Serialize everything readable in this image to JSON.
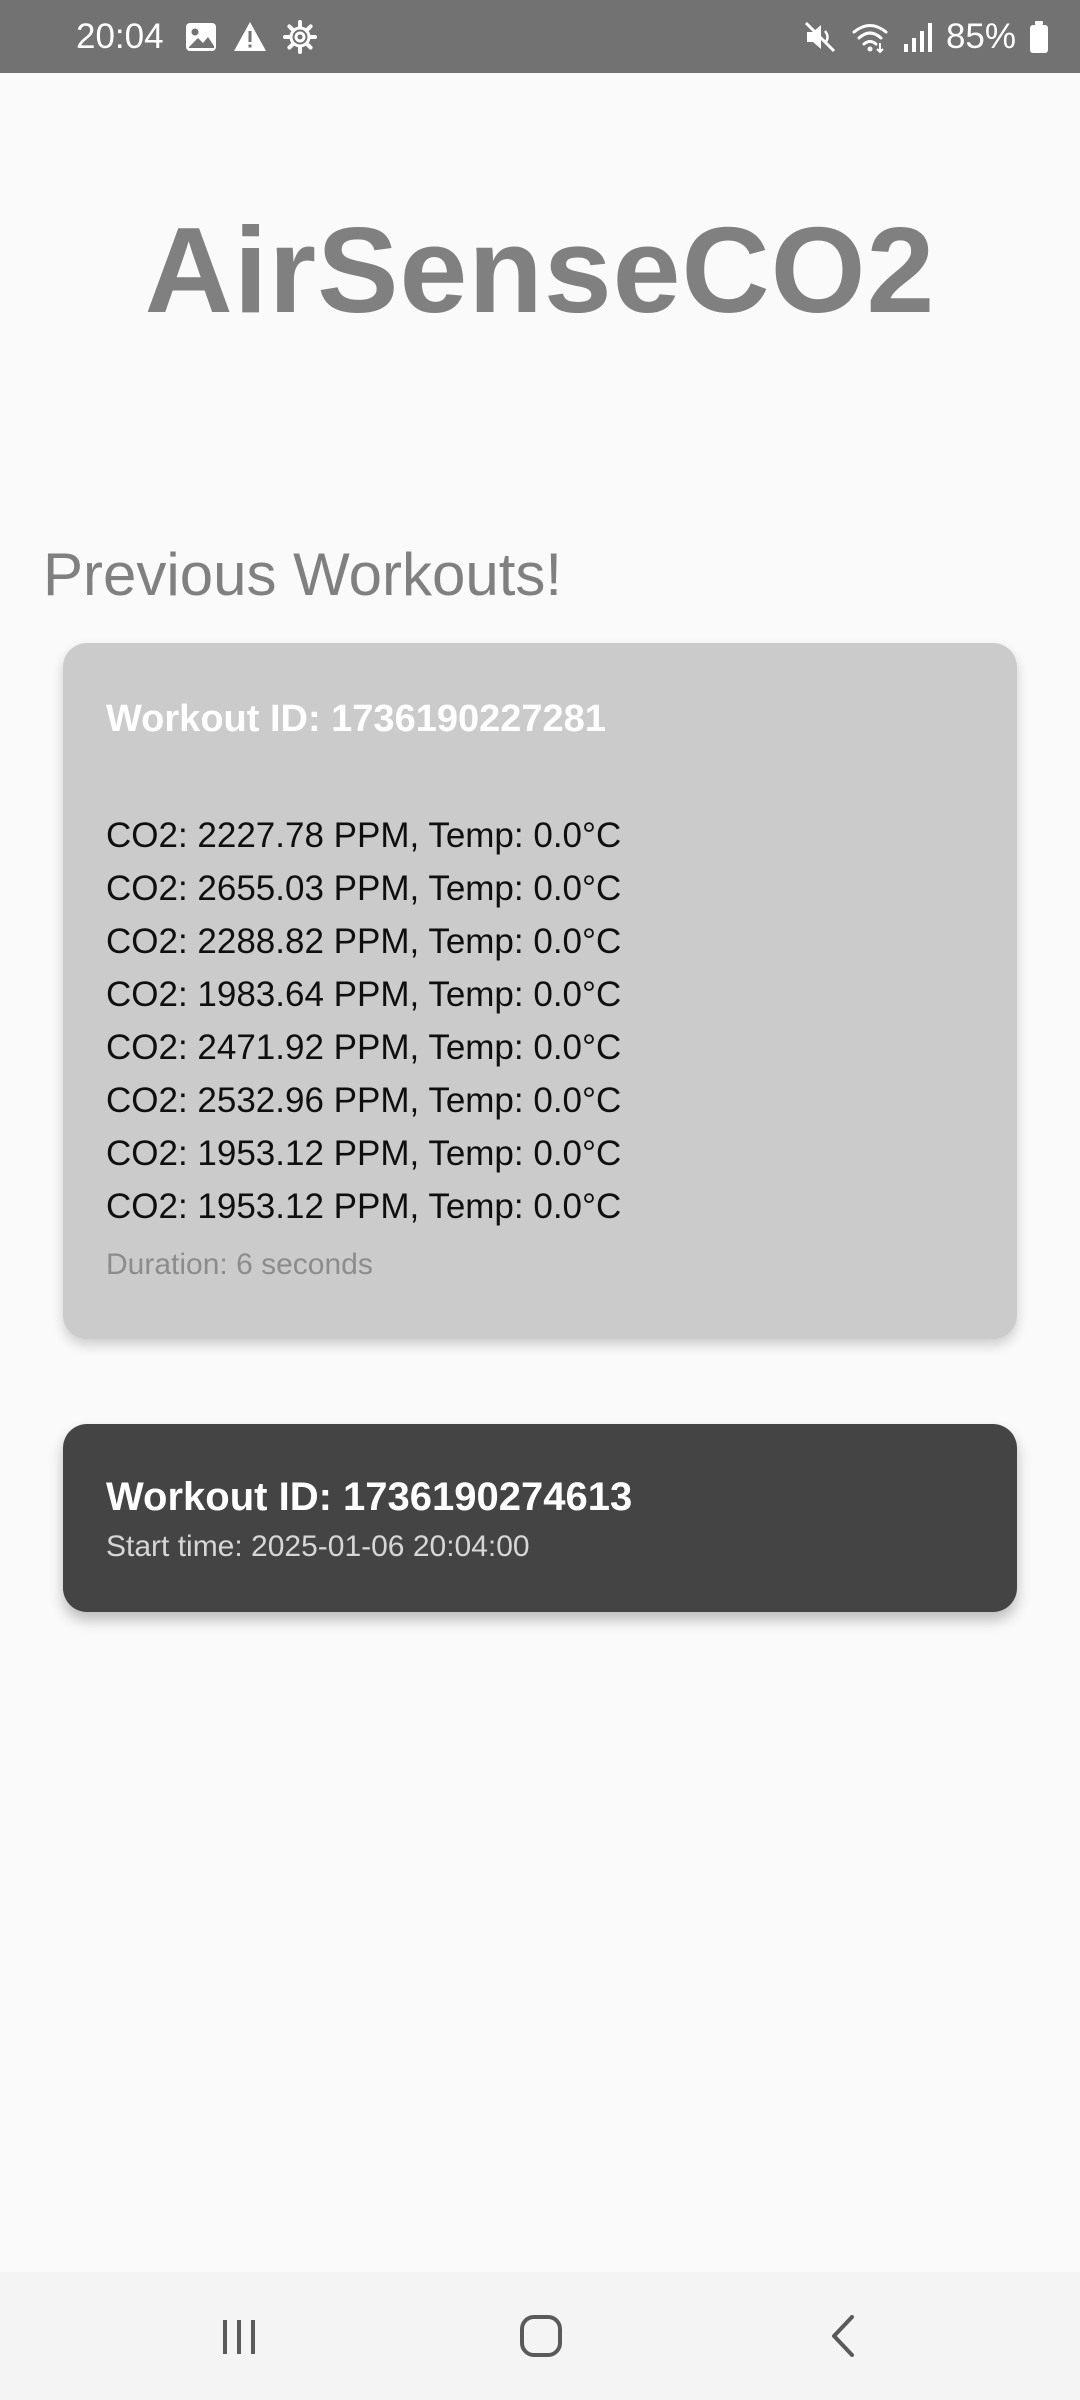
{
  "status_bar": {
    "time": "20:04",
    "left_icons": [
      "image-icon",
      "warning-icon",
      "settings-icon"
    ],
    "right_icons": [
      "mute-icon",
      "wifi-icon",
      "signal-icon"
    ],
    "battery_percent": "85%"
  },
  "app": {
    "title": "AirSenseCO2"
  },
  "section": {
    "heading": "Previous Workouts!"
  },
  "workouts": [
    {
      "id_label": "Workout ID: 1736190227281",
      "readings": [
        "CO2: 2227.78 PPM, Temp: 0.0°C",
        "CO2: 2655.03 PPM, Temp: 0.0°C",
        "CO2: 2288.82 PPM, Temp: 0.0°C",
        "CO2: 1983.64 PPM, Temp: 0.0°C",
        "CO2: 2471.92 PPM, Temp: 0.0°C",
        "CO2: 2532.96 PPM, Temp: 0.0°C",
        "CO2: 1953.12 PPM, Temp: 0.0°C",
        "CO2: 1953.12 PPM, Temp: 0.0°C"
      ],
      "duration": "Duration: 6 seconds"
    },
    {
      "id_label": "Workout ID: 1736190274613",
      "start_time": "Start time: 2025-01-06 20:04:00"
    }
  ],
  "nav_bar": {
    "buttons": [
      "recents",
      "home",
      "back"
    ]
  },
  "colors": {
    "status_bar": "#727272",
    "background": "#fafafa",
    "title": "#808080",
    "card_light": "#cbcbcb",
    "card_dark": "#444444"
  }
}
